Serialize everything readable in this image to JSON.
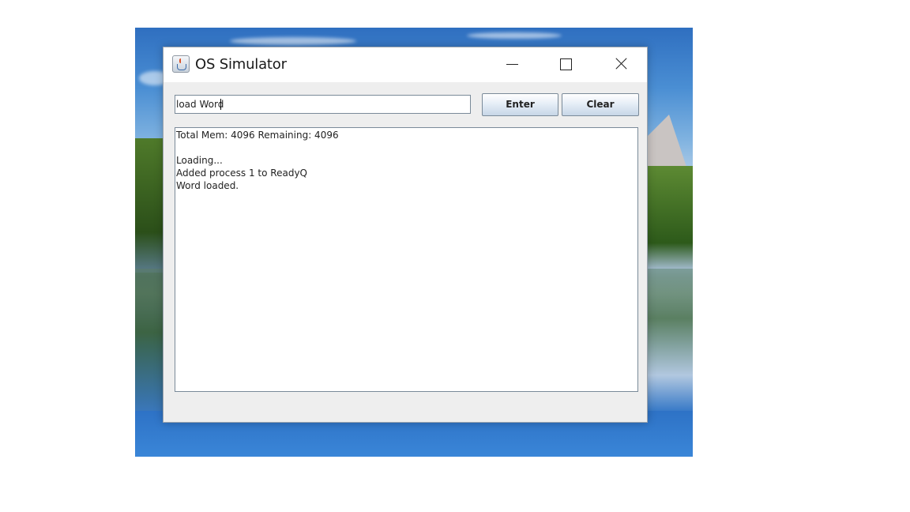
{
  "window": {
    "title": "OS Simulator",
    "app_icon": "java-cup-icon"
  },
  "controls": {
    "minimize_icon": "minimize-icon",
    "maximize_icon": "maximize-icon",
    "close_icon": "close-icon"
  },
  "command": {
    "value": "load Word",
    "enter_label": "Enter",
    "clear_label": "Clear"
  },
  "console": {
    "lines": [
      "Total Mem: 4096 Remaining: 4096",
      "",
      "Loading...",
      "Added process 1 to ReadyQ",
      "Word loaded."
    ]
  }
}
